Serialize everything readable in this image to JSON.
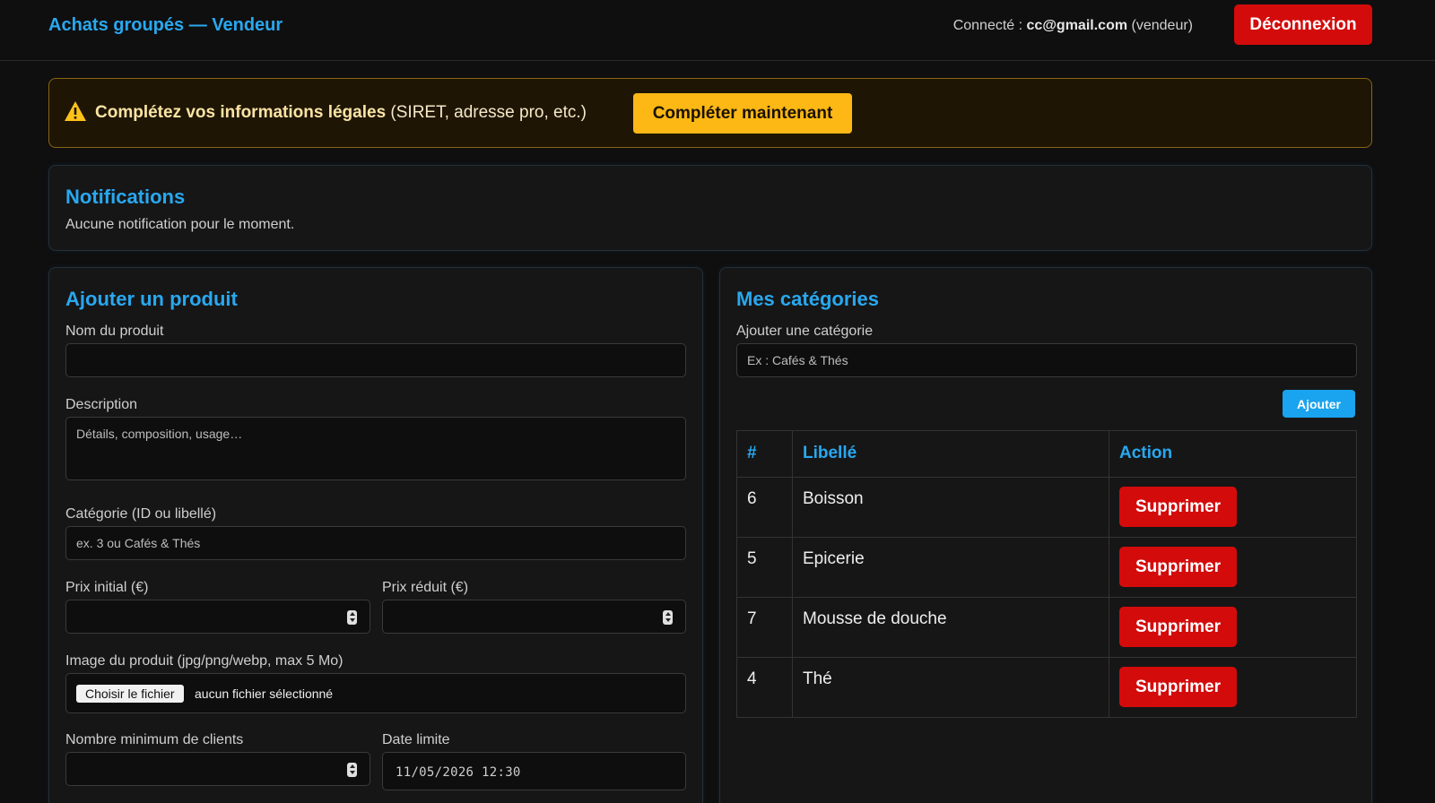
{
  "header": {
    "brand": "Achats groupés — Vendeur",
    "connected_prefix": "Connecté :",
    "email": "cc@gmail.com",
    "role": "(vendeur)",
    "logout_label": "Déconnexion"
  },
  "alert": {
    "icon": "warning-icon",
    "title": "Complétez vos informations légales",
    "detail": "(SIRET, adresse pro, etc.)",
    "button_label": "Compléter maintenant",
    "color": "#fdb815"
  },
  "notifications": {
    "title": "Notifications",
    "empty_text": "Aucune notification pour le moment."
  },
  "product_form": {
    "title": "Ajouter un produit",
    "name_label": "Nom du produit",
    "name_value": "",
    "description_label": "Description",
    "description_placeholder": "Détails, composition, usage…",
    "category_label": "Catégorie (ID ou libellé)",
    "category_placeholder": "ex. 3 ou Cafés & Thés",
    "initial_price_label": "Prix initial (€)",
    "reduced_price_label": "Prix réduit (€)",
    "image_label": "Image du produit (jpg/png/webp, max 5 Mo)",
    "file_button_label": "Choisir le fichier",
    "file_status": "aucun fichier sélectionné",
    "min_clients_label": "Nombre minimum de clients",
    "deadline_label": "Date limite",
    "deadline_value": "11/05/2026 12:30"
  },
  "categories": {
    "title": "Mes catégories",
    "add_label": "Ajouter une catégorie",
    "add_placeholder": "Ex : Cafés & Thés",
    "add_button_label": "Ajouter",
    "columns": [
      "#",
      "Libellé",
      "Action"
    ],
    "rows": [
      {
        "id": "6",
        "label": "Boisson",
        "action": "Supprimer"
      },
      {
        "id": "5",
        "label": "Epicerie",
        "action": "Supprimer"
      },
      {
        "id": "7",
        "label": "Mousse de douche",
        "action": "Supprimer"
      },
      {
        "id": "4",
        "label": "Thé",
        "action": "Supprimer"
      }
    ]
  },
  "colors": {
    "accent": "#29a8ef",
    "danger": "#d40b0b",
    "background": "#0f0f10"
  }
}
